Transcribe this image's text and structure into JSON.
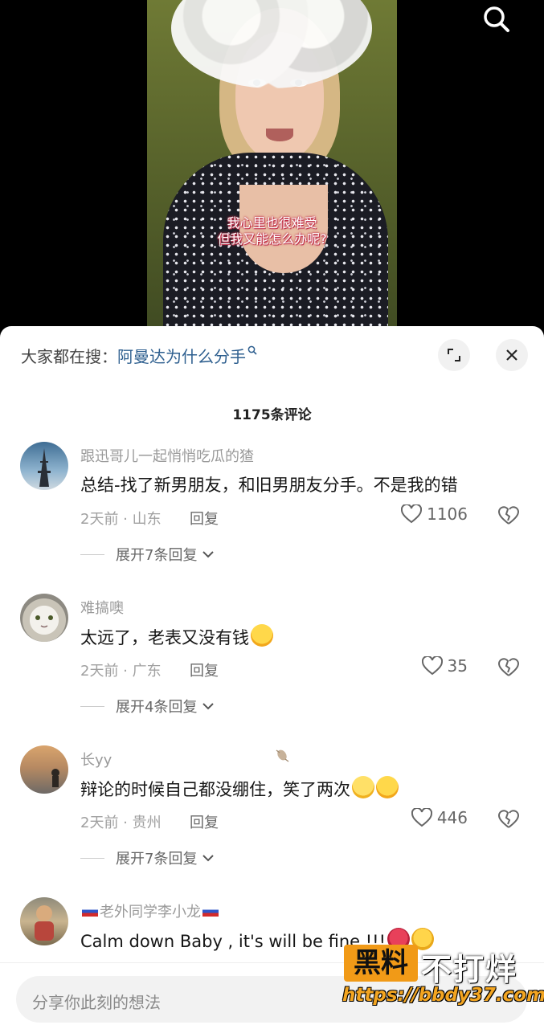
{
  "video": {
    "subtitle_line1": "我心里也很难受",
    "subtitle_line2": "但我又能怎么办呢?"
  },
  "search_bar": {
    "prefix": "大家都在搜：",
    "query": "阿曼达为什么分手"
  },
  "comments_count": "1175条评论",
  "comments": [
    {
      "username": "跟迅哥儿一起悄悄吃瓜的猹",
      "text": "总结-找了新男朋友，和旧男朋友分手。不是我的错",
      "meta": "2天前 · 山东",
      "reply_label": "回复",
      "likes": "1106",
      "expand": "展开7条回复"
    },
    {
      "username": "难搞噢",
      "text": "太远了，老表又没有钱",
      "meta": "2天前 · 广东",
      "reply_label": "回复",
      "likes": "35",
      "expand": "展开4条回复"
    },
    {
      "username": "长yy",
      "text": "辩论的时候自己都没绷住，笑了两次",
      "meta": "2天前 · 贵州",
      "reply_label": "回复",
      "likes": "446",
      "expand": "展开7条回复"
    },
    {
      "username": "老外同学李小龙",
      "text": "Calm down Baby , it's will be fine !!!"
    }
  ],
  "input": {
    "placeholder": "分享你此刻的想法"
  },
  "watermark": {
    "brand_box": "黑料",
    "brand_text": "不打烊",
    "url": "https://bbdy37.com"
  },
  "colors": {
    "link": "#2e5f8f",
    "subtitle_outline": "#c0304a",
    "watermark_orange": "#f19a17"
  }
}
